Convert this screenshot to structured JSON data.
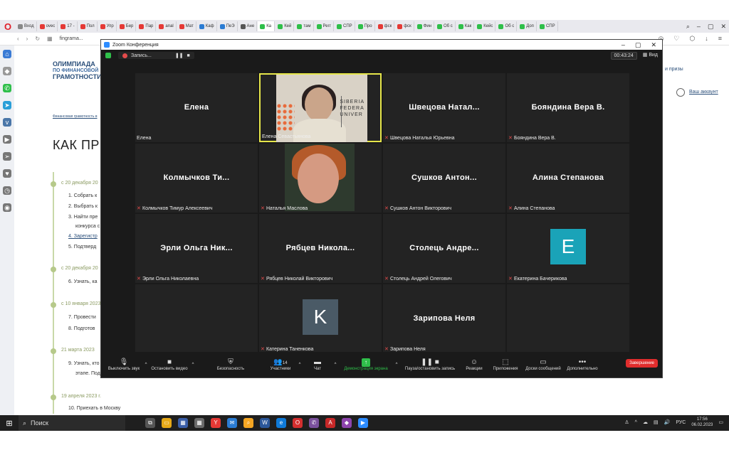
{
  "browser": {
    "tabs": [
      "Вход",
      "ovec",
      "17 -",
      "Пол",
      "Упр",
      "Бер",
      "Пар",
      "anal",
      "Мат",
      "Каф",
      "ПеЭ",
      "Ане",
      "Ка",
      "Кей",
      "там",
      "Регг",
      "СПР",
      "Про",
      "фск",
      "фск",
      "Фин",
      "Об с",
      "Как",
      "Кейс",
      "Об с",
      "Доп",
      "СПР"
    ],
    "url": "fingrama...",
    "page": {
      "logo_line1": "ОЛИМПИАДА",
      "logo_line2": "ПО ФИНАНСОВОЙ",
      "logo_line3": "ГРАМОТНОСТИ",
      "breadcrumb": "Финансовая грамотность в",
      "title": "КАК ПРИ",
      "right_link": "и призы",
      "account_link": "Ваш аккаунт",
      "timeline": [
        {
          "date": "с 20 декабря 20",
          "items": [
            "1. Собрать к",
            "2. Выбрать к",
            "3. Найти пре",
            "конкурса с",
            "4. Зарегистр",
            "5. Подтверд"
          ]
        },
        {
          "date": "с 20 декабря 20",
          "items": [
            "6. Узнать, ка"
          ]
        },
        {
          "date": "с 10 января 2023",
          "items": [
            "7. Провести",
            "8. Подготов"
          ]
        },
        {
          "date": "21 марта 2023",
          "items": [
            "9. Узнать, кто",
            "этапе. Под"
          ]
        },
        {
          "date": "19 апреля 2023 г.",
          "items": [
            "10. Приехать в Москву"
          ]
        }
      ]
    }
  },
  "zoom": {
    "title": "Zoom Конференция",
    "recording_label": "Запись...",
    "timer": "00:43:24",
    "view_label": "Вид",
    "participants": [
      {
        "big": "Елена",
        "label": "Елена",
        "muted": false,
        "type": "name"
      },
      {
        "big": "",
        "label": "Елена Севастьянова",
        "muted": false,
        "type": "video1",
        "active": true
      },
      {
        "big": "Швецова Натал...",
        "label": "Швецова Наталья Юрьевна",
        "muted": true,
        "type": "name"
      },
      {
        "big": "Бояндина Вера В.",
        "label": "Бояндина Вера В.",
        "muted": true,
        "type": "name"
      },
      {
        "big": "Колмычков Ти...",
        "label": "Колмычков Тимур Алексеевич",
        "muted": true,
        "type": "name"
      },
      {
        "big": "",
        "label": "Наталья Маслова",
        "muted": true,
        "type": "video2"
      },
      {
        "big": "Сушков Антон...",
        "label": "Сушков Антон Викторович",
        "muted": true,
        "type": "name"
      },
      {
        "big": "Алина Степанова",
        "label": "Алина Степанова",
        "muted": true,
        "type": "name"
      },
      {
        "big": "Эрли Ольга Ник...",
        "label": "Эрли Ольга Николаевна",
        "muted": true,
        "type": "name"
      },
      {
        "big": "Рябцев Никола...",
        "label": "Рябцев Николай Викторович",
        "muted": true,
        "type": "name"
      },
      {
        "big": "Столець Андре...",
        "label": "Столець Андрей Олегович",
        "muted": true,
        "type": "name"
      },
      {
        "big": "E",
        "label": "Екатерина Бачерикова",
        "muted": true,
        "type": "avatar",
        "color": "#1aa3b8"
      },
      {
        "big": "",
        "label": "",
        "muted": false,
        "type": "empty"
      },
      {
        "big": "K",
        "label": "Катерина Таненкова",
        "muted": true,
        "type": "avatar",
        "color": "#4a5a66"
      },
      {
        "big": "Зарипова Неля",
        "label": "Зарипова Неля",
        "muted": true,
        "type": "name"
      },
      {
        "big": "",
        "label": "",
        "muted": false,
        "type": "empty"
      }
    ],
    "video1_text": [
      "SIBERIA",
      "FEDERA",
      "UNIVER"
    ],
    "toolbar": {
      "mute": "Выключить звук",
      "video": "Остановить видео",
      "security": "Безопасность",
      "participants": "Участники",
      "participants_count": "14",
      "chat": "Чат",
      "share": "Демонстрация экрана",
      "record": "Пауза/остановить запись",
      "reactions": "Реакции",
      "apps": "Приложения",
      "whiteboard": "Доски сообщений",
      "more": "Дополнительно",
      "end": "Завершение"
    }
  },
  "taskbar": {
    "search": "Поиск",
    "lang": "РУС",
    "time": "17:56",
    "date": "06.02.2023"
  }
}
